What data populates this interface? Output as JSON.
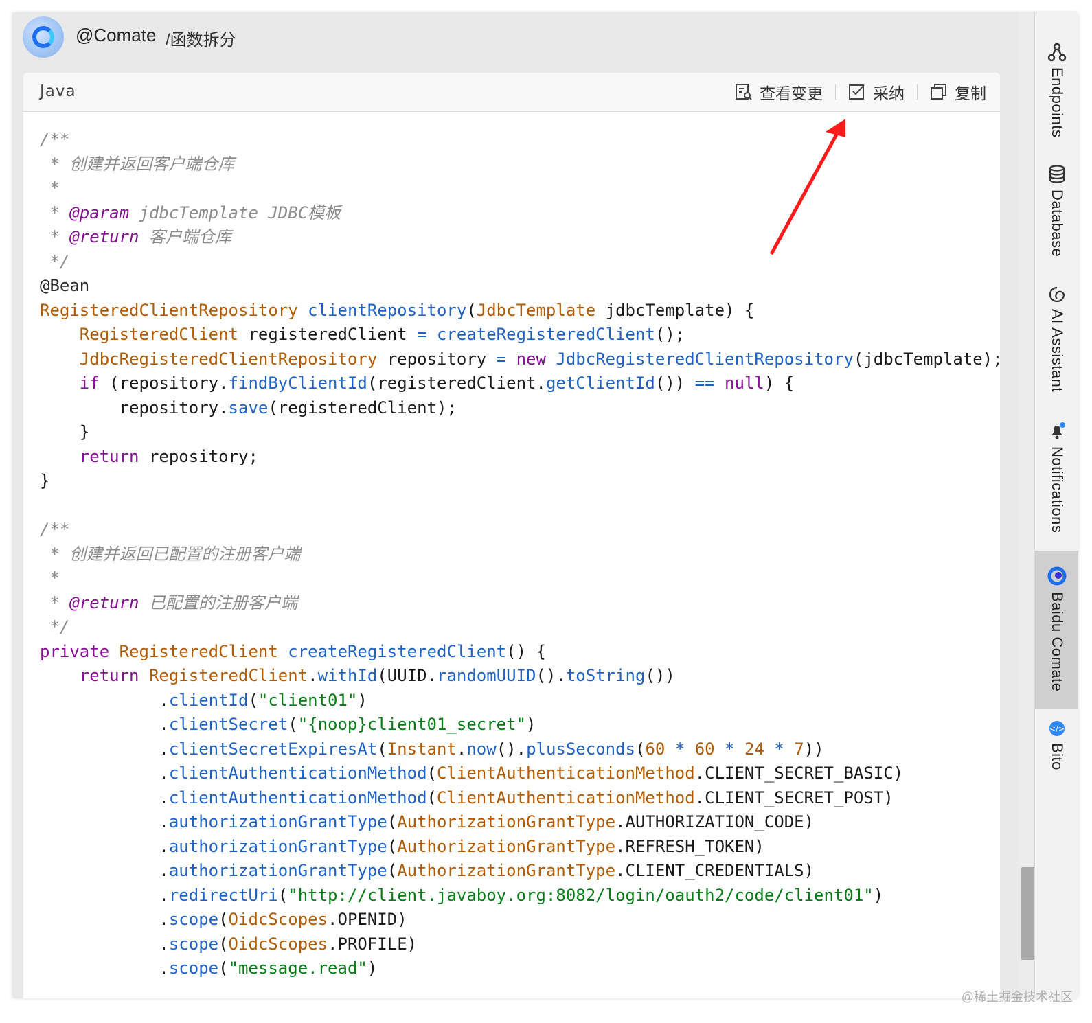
{
  "header": {
    "sender": "@Comate",
    "command": "/函数拆分"
  },
  "card": {
    "language": "Java",
    "actions": {
      "view_changes": "查看变更",
      "adopt": "采纳",
      "copy": "复制"
    }
  },
  "code_lines": [
    "/**",
    " * 创建并返回客户端仓库",
    " *",
    " * @param jdbcTemplate JDBC模板",
    " * @return 客户端仓库",
    " */",
    "@Bean",
    "RegisteredClientRepository clientRepository(JdbcTemplate jdbcTemplate) {",
    "    RegisteredClient registeredClient = createRegisteredClient();",
    "    JdbcRegisteredClientRepository repository = new JdbcRegisteredClientRepository(jdbcTemplate);",
    "    if (repository.findByClientId(registeredClient.getClientId()) == null) {",
    "        repository.save(registeredClient);",
    "    }",
    "    return repository;",
    "}",
    "",
    "/**",
    " * 创建并返回已配置的注册客户端",
    " *",
    " * @return 已配置的注册客户端",
    " */",
    "private RegisteredClient createRegisteredClient() {",
    "    return RegisteredClient.withId(UUID.randomUUID().toString())",
    "            .clientId(\"client01\")",
    "            .clientSecret(\"{noop}client01_secret\")",
    "            .clientSecretExpiresAt(Instant.now().plusSeconds(60 * 60 * 24 * 7))",
    "            .clientAuthenticationMethod(ClientAuthenticationMethod.CLIENT_SECRET_BASIC)",
    "            .clientAuthenticationMethod(ClientAuthenticationMethod.CLIENT_SECRET_POST)",
    "            .authorizationGrantType(AuthorizationGrantType.AUTHORIZATION_CODE)",
    "            .authorizationGrantType(AuthorizationGrantType.REFRESH_TOKEN)",
    "            .authorizationGrantType(AuthorizationGrantType.CLIENT_CREDENTIALS)",
    "            .redirectUri(\"http://client.javaboy.org:8082/login/oauth2/code/client01\")",
    "            .scope(OidcScopes.OPENID)",
    "            .scope(OidcScopes.PROFILE)",
    "            .scope(\"message.read\")"
  ],
  "right_rail": {
    "items": [
      "Endpoints",
      "Database",
      "AI Assistant",
      "Notifications",
      "Baidu Comate",
      "Bito"
    ],
    "active": "Baidu Comate"
  },
  "watermark": "@稀土掘金技术社区",
  "colors": {
    "accent_arrow": "#ff1a1a",
    "keyword": "#871094",
    "type": "#b35b00",
    "method": "#1f62c6",
    "string": "#067d17",
    "comment": "#8c8c8c"
  }
}
